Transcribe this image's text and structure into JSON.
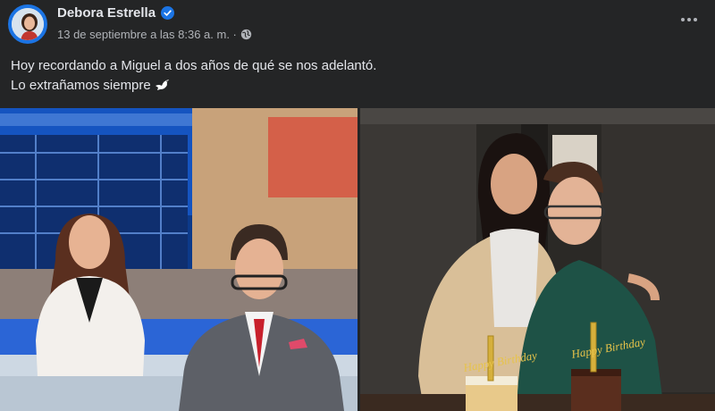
{
  "post": {
    "author": "Debora Estrella",
    "timestamp": "13 de septiembre a las 8:36 a. m. ·",
    "text_line1": "Hoy recordando a Miguel a dos años de qué se nos adelantó.",
    "text_line2": "Lo extrañamos siempre"
  },
  "icons": {
    "verified": "verified-badge-icon",
    "privacy": "globe-icon",
    "more": "more-options-icon",
    "emoji": "dove-emoji"
  },
  "colors": {
    "background": "#242526",
    "text_primary": "#e4e6eb",
    "text_secondary": "#b0b3b8",
    "verified_blue": "#1b74e4"
  },
  "cake_text": {
    "left": "Happy Birthday",
    "right": "Happy Birthday"
  }
}
